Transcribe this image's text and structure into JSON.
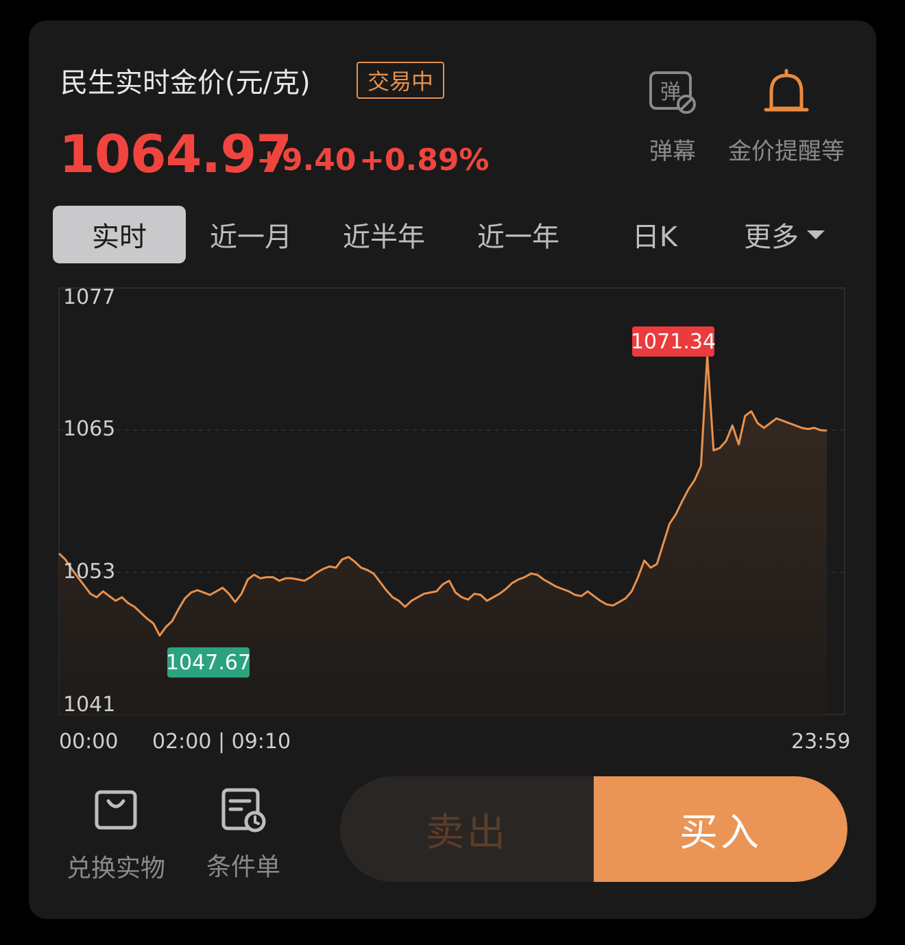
{
  "header": {
    "title": "民生实时金价(元/克)",
    "status_badge": "交易中",
    "price": "1064.97",
    "change": "+9.40",
    "change_pct": "+0.89%"
  },
  "tools": {
    "danmu_icon_text": "弹",
    "danmu_label": "弹幕",
    "alert_label": "金价提醒等"
  },
  "tabs": [
    "实时",
    "近一月",
    "近半年",
    "近一年",
    "日K",
    "更多"
  ],
  "active_tab": "实时",
  "chart_data": {
    "type": "line",
    "y_ticks": [
      "1077",
      "1065",
      "1053",
      "1041"
    ],
    "ylim": [
      1041,
      1077
    ],
    "x_ticks": [
      "00:00",
      "02:00 | 09:10",
      "23:59"
    ],
    "high_label": "1071.34",
    "low_label": "1047.67",
    "series": [
      {
        "color": "#e8914d",
        "values": [
          1054.6,
          1054.1,
          1053.3,
          1052.6,
          1051.9,
          1051.2,
          1050.9,
          1051.4,
          1051.0,
          1050.6,
          1050.9,
          1050.4,
          1050.1,
          1049.6,
          1049.1,
          1048.7,
          1047.67,
          1048.4,
          1048.9,
          1049.9,
          1050.8,
          1051.3,
          1051.5,
          1051.3,
          1051.1,
          1051.4,
          1051.7,
          1051.2,
          1050.5,
          1051.2,
          1052.4,
          1052.8,
          1052.5,
          1052.6,
          1052.6,
          1052.3,
          1052.5,
          1052.5,
          1052.4,
          1052.3,
          1052.6,
          1053.0,
          1053.3,
          1053.5,
          1053.4,
          1054.1,
          1054.3,
          1053.9,
          1053.4,
          1053.2,
          1052.9,
          1052.2,
          1051.5,
          1050.9,
          1050.6,
          1050.1,
          1050.6,
          1050.9,
          1051.2,
          1051.3,
          1051.4,
          1052.0,
          1052.3,
          1051.3,
          1050.9,
          1050.7,
          1051.2,
          1051.1,
          1050.6,
          1050.9,
          1051.2,
          1051.6,
          1052.1,
          1052.4,
          1052.6,
          1052.9,
          1052.8,
          1052.4,
          1052.1,
          1051.8,
          1051.6,
          1051.4,
          1051.1,
          1051.0,
          1051.4,
          1051.0,
          1050.6,
          1050.3,
          1050.2,
          1050.5,
          1050.8,
          1051.4,
          1052.6,
          1054.0,
          1053.4,
          1053.7,
          1055.4,
          1057.1,
          1057.9,
          1059.0,
          1060.0,
          1060.8,
          1062.0,
          1071.34,
          1063.3,
          1063.5,
          1064.1,
          1065.4,
          1063.8,
          1066.2,
          1066.6,
          1065.6,
          1065.2,
          1065.6,
          1066.0,
          1065.8,
          1065.6,
          1065.4,
          1065.2,
          1065.1,
          1065.2,
          1065.0,
          1064.97
        ]
      }
    ]
  },
  "bottom": {
    "redeem_label": "兑换实物",
    "condition_label": "条件单",
    "sell_label": "卖出",
    "buy_label": "买入"
  }
}
